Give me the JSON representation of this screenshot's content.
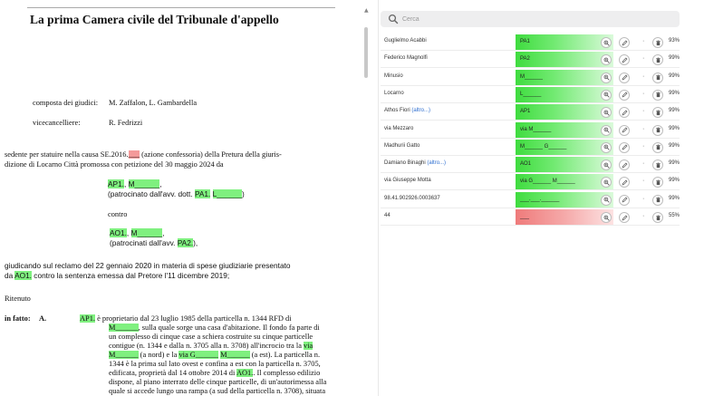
{
  "document": {
    "title": "La prima Camera civile del Tribunale d'appello",
    "composta_label": "composta dei giudici:",
    "composta_value": "M. Zaffalon, L. Gambardella",
    "vicecanc_label": "vicecancelliere:",
    "vicecanc_value": "R. Fedrizzi",
    "sede_1a": "sedente per statuire nella causa SE.2016.",
    "sede_1b": "___",
    "sede_1c": " (azione confessoria) della Pretura della giuris-",
    "sede_2": "dizione di Locarno Città promossa con petizione del 30 maggio 2024 da",
    "party1_a": "AP1.",
    "party1_sep": ", ",
    "party1_b": "M______",
    "party1_end": ",",
    "patro1_a": "(patrocinato dall'avv. dott. ",
    "patro1_b": "PA1.",
    "patro1_sep": " ",
    "patro1_c": "L______",
    "patro1_end": ")",
    "contro": "contro",
    "party2_a": "AO1.",
    "party2_sep": ", ",
    "party2_b": "M______",
    "party2_end": ",",
    "patro2_a": "(patrocinati dall'avv. ",
    "patro2_b": "PA2.",
    "patro2_end": "),",
    "giud_1": "giudicando sul reclamo del 22 gennaio 2020 in materia di spese giudiziarie presentato",
    "giud_2a": "da ",
    "giud_2b": "AO1.",
    "giud_2c": " contro la sentenza emessa dal Pretore l'11 dicembre 2019;",
    "ritenuto": "Ritenuto",
    "fatto_label": "in fatto:",
    "fatto_letter": "A.",
    "f1a": "AP1.",
    "f1b": " è proprietario dal 23 luglio 1985 della particella n. 1344 RFD di",
    "f2a": "M______",
    "f2b": ", sulla quale sorge una casa d'abitazione. Il fondo fa parte di",
    "f3": "un complesso di cinque case a schiera costruite su cinque particelle",
    "f4a": "contigue (n. 1344 e dalla n. 3705 alla n. 3708) all'incrocio tra la ",
    "f4b": "via",
    "f5a": "M______",
    "f5b": " (a nord) e la ",
    "f5c": "via G______",
    "f5d": " ",
    "f5e": "M______",
    "f5f": " (a est). La particella n.",
    "f6": "1344 è la prima sul lato ovest e confina a est con la particella n. 3705,",
    "f7a": "edificata, proprietà dal 14 ottobre 2014 di ",
    "f7b": "AO1.",
    "f7c": ". Il complesso edilizio",
    "f8": "dispone, al piano interrato delle cinque particelle, di un'autorimessa alla",
    "f9": "quale si accede lungo una rampa (a sud della particella n. 3708), situata"
  },
  "search": {
    "placeholder": "Cerca"
  },
  "entities": [
    {
      "name": "Guglielmo Acabbi",
      "alt": "",
      "tag": "PA1",
      "status": "ok",
      "pct": "93%"
    },
    {
      "name": "Federico Magnolfi",
      "alt": "",
      "tag": "PA2",
      "status": "ok",
      "pct": "99%"
    },
    {
      "name": "Minusio",
      "alt": "",
      "tag": "M______",
      "status": "ok",
      "pct": "99%"
    },
    {
      "name": "Locarno",
      "alt": "",
      "tag": "L______",
      "status": "ok",
      "pct": "99%"
    },
    {
      "name": "Athos Fiori ",
      "alt": "(altro...)",
      "tag": "AP1",
      "status": "ok",
      "pct": "99%"
    },
    {
      "name": "via Mezzaro",
      "alt": "",
      "tag": "via M______",
      "status": "ok",
      "pct": "99%"
    },
    {
      "name": "Madhurii Gatto",
      "alt": "",
      "tag": "M______ G______",
      "status": "ok",
      "pct": "99%"
    },
    {
      "name": "Damiano Binaghi ",
      "alt": "(altro...)",
      "tag": "AO1",
      "status": "ok",
      "pct": "99%"
    },
    {
      "name": "via Giuseppe Motta",
      "alt": "",
      "tag": "via G______ M______",
      "status": "ok",
      "pct": "99%"
    },
    {
      "name": "98.41.902926.0003637",
      "alt": "",
      "tag": "___.___.______",
      "status": "ok",
      "pct": "99%"
    },
    {
      "name": "44",
      "alt": "",
      "tag": "___",
      "status": "bad",
      "pct": "55%"
    }
  ],
  "icons": {
    "search": "search-icon",
    "zoom": "zoom-in-icon",
    "edit": "pencil-icon",
    "more": "more-icon",
    "delete": "trash-icon"
  },
  "colors": {
    "highlight": "#7ff07f",
    "ok_tag": "#3fdc3f",
    "bad_tag": "#ef7b7b"
  }
}
